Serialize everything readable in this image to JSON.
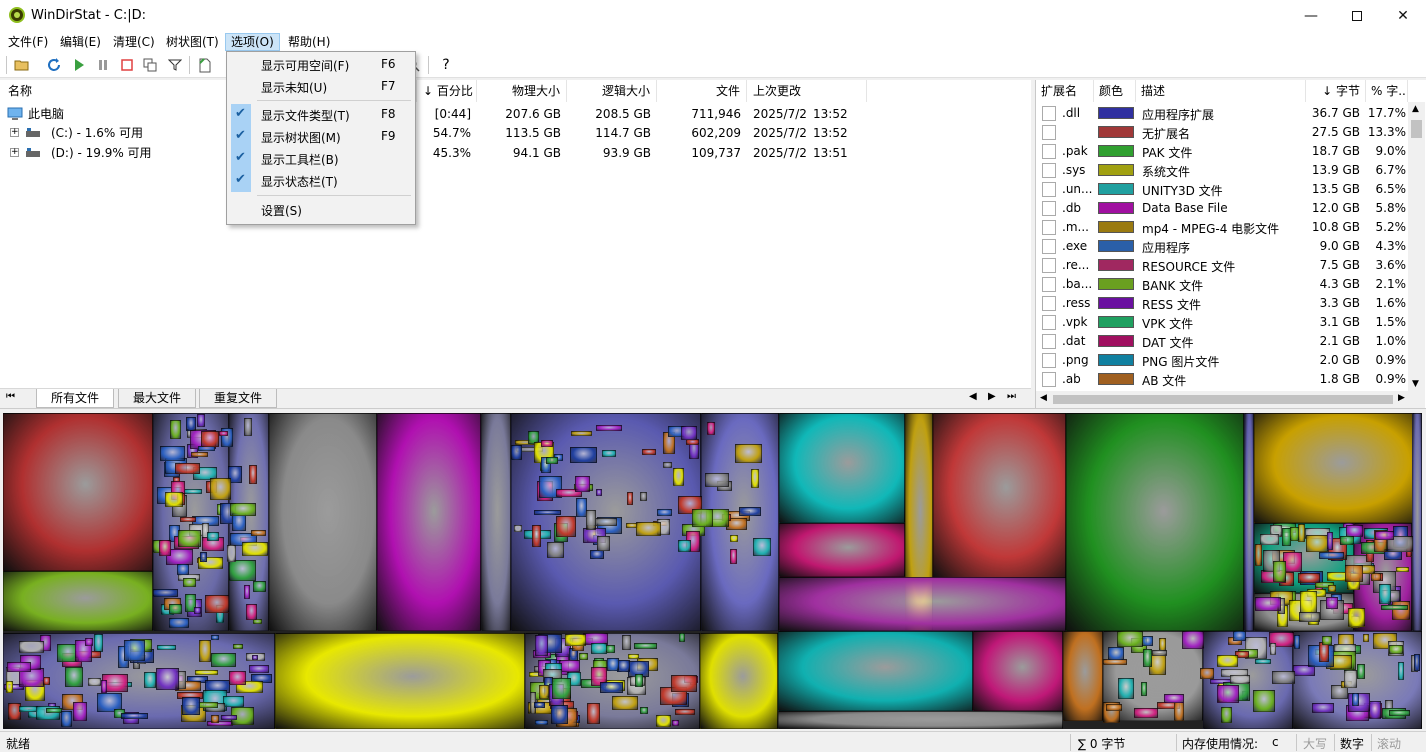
{
  "window": {
    "title": "WinDirStat - C:|D:"
  },
  "menu": [
    "文件(F)",
    "编辑(E)",
    "清理(C)",
    "树状图(T)",
    "选项(O)",
    "帮助(H)"
  ],
  "options_menu": {
    "items": [
      {
        "label": "显示可用空间(F)",
        "key": "F6",
        "checked": false
      },
      {
        "label": "显示未知(U)",
        "key": "F7",
        "checked": false
      },
      {
        "label": "显示文件类型(T)",
        "key": "F8",
        "checked": true
      },
      {
        "label": "显示树状图(M)",
        "key": "F9",
        "checked": true
      },
      {
        "label": "显示工具栏(B)",
        "key": "",
        "checked": true
      },
      {
        "label": "显示状态栏(T)",
        "key": "",
        "checked": true
      },
      {
        "label": "设置(S)",
        "key": "",
        "checked": false
      }
    ]
  },
  "toolbar": {
    "icons": [
      "open-icon",
      "refresh-icon",
      "play-icon",
      "pause-icon",
      "stop-icon",
      "copy-icon",
      "filter-icon",
      "clean-icon",
      "search-icon",
      "help-icon"
    ],
    "help_label": "?"
  },
  "tree": {
    "columns": {
      "name": "名称",
      "percent": "↓ 百分比",
      "physical": "物理大小",
      "logical": "逻辑大小",
      "files": "文件",
      "modified": "上次更改"
    },
    "rows": [
      {
        "name": "此电脑",
        "percent": "[0:44]",
        "physical": "207.6 GB",
        "logical": "208.5 GB",
        "files": "711,946",
        "date": "2025/7/2",
        "time": "13:52"
      },
      {
        "name": "(C:) - 1.6% 可用",
        "percent": "54.7%",
        "physical": "113.5 GB",
        "logical": "114.7 GB",
        "files": "602,209",
        "date": "2025/7/2",
        "time": "13:52"
      },
      {
        "name": "(D:) - 19.9% 可用",
        "percent": "45.3%",
        "physical": "94.1 GB",
        "logical": "93.9 GB",
        "files": "109,737",
        "date": "2025/7/2",
        "time": "13:51"
      }
    ]
  },
  "tabs": [
    "所有文件",
    "最大文件",
    "重复文件"
  ],
  "ext_table": {
    "columns": {
      "ext": "扩展名",
      "color": "颜色",
      "desc": "描述",
      "bytes": "↓ 字节",
      "pct": "% 字..."
    },
    "rows": [
      {
        "ext": ".dll",
        "color": "#3030a0",
        "desc": "应用程序扩展",
        "bytes": "36.7 GB",
        "pct": "17.7%"
      },
      {
        "ext": "",
        "color": "#a03838",
        "desc": "无扩展名",
        "bytes": "27.5 GB",
        "pct": "13.3%"
      },
      {
        "ext": ".pak",
        "color": "#30a030",
        "desc": "PAK 文件",
        "bytes": "18.7 GB",
        "pct": "9.0%"
      },
      {
        "ext": ".sys",
        "color": "#a0a010",
        "desc": "系统文件",
        "bytes": "13.9 GB",
        "pct": "6.7%"
      },
      {
        "ext": ".un...",
        "color": "#20a0a0",
        "desc": "UNITY3D 文件",
        "bytes": "13.5 GB",
        "pct": "6.5%"
      },
      {
        "ext": ".db",
        "color": "#a010a0",
        "desc": "Data Base File",
        "bytes": "12.0 GB",
        "pct": "5.8%"
      },
      {
        "ext": ".m...",
        "color": "#9a7a10",
        "desc": "mp4 - MPEG-4 电影文件",
        "bytes": "10.8 GB",
        "pct": "5.2%"
      },
      {
        "ext": ".exe",
        "color": "#2a5fa8",
        "desc": "应用程序",
        "bytes": "9.0 GB",
        "pct": "4.3%"
      },
      {
        "ext": ".re...",
        "color": "#a02860",
        "desc": "RESOURCE 文件",
        "bytes": "7.5 GB",
        "pct": "3.6%"
      },
      {
        "ext": ".ba...",
        "color": "#6aa020",
        "desc": "BANK 文件",
        "bytes": "4.3 GB",
        "pct": "2.1%"
      },
      {
        "ext": ".ress",
        "color": "#6a10a0",
        "desc": "RESS 文件",
        "bytes": "3.3 GB",
        "pct": "1.6%"
      },
      {
        "ext": ".vpk",
        "color": "#20a060",
        "desc": "VPK 文件",
        "bytes": "3.1 GB",
        "pct": "1.5%"
      },
      {
        "ext": ".dat",
        "color": "#a01060",
        "desc": "DAT 文件",
        "bytes": "2.1 GB",
        "pct": "1.0%"
      },
      {
        "ext": ".png",
        "color": "#1080a0",
        "desc": "PNG 图片文件",
        "bytes": "2.0 GB",
        "pct": "0.9%"
      },
      {
        "ext": ".ab",
        "color": "#a06020",
        "desc": "AB 文件",
        "bytes": "1.8 GB",
        "pct": "0.9%"
      }
    ]
  },
  "status": {
    "left": "就绪",
    "sum": "∑ 0 字节",
    "memory": "内存使用情况:",
    "memory_val": "c",
    "caps": "大写",
    "num": "数字",
    "scroll": "滚动"
  },
  "colors": {
    "accent": "#cce4f7",
    "check_bg": "#a9d2f5"
  }
}
